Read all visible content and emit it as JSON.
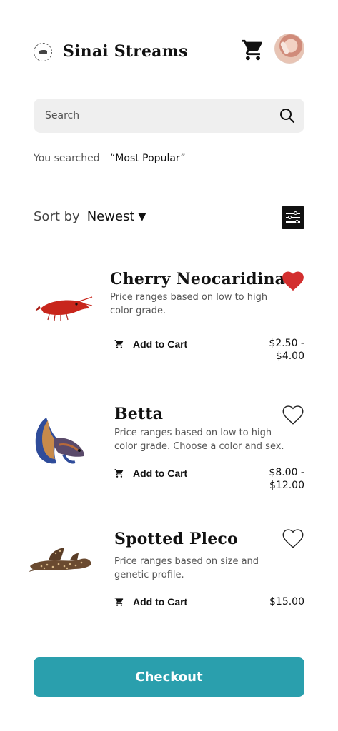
{
  "header": {
    "brand": "Sinai Streams",
    "logo_icon": "logo-icon",
    "cart_icon": "cart-icon"
  },
  "search": {
    "placeholder": "Search",
    "value": ""
  },
  "searched": {
    "label": "You searched",
    "term": "“Most Popular”"
  },
  "sort": {
    "label": "Sort by",
    "value": "Newest",
    "caret": "▼"
  },
  "products": [
    {
      "name": "Cherry Neocaridina",
      "description": "Price ranges based on low to high color grade.",
      "add_label": "Add to Cart",
      "price_line1": "$2.50 -",
      "price_line2": "$4.00",
      "favorited": true
    },
    {
      "name": "Betta",
      "description": "Price ranges based on low to high color grade. Choose a color and sex.",
      "add_label": "Add to Cart",
      "price_line1": "$8.00 -",
      "price_line2": "$12.00",
      "favorited": false
    },
    {
      "name": "Spotted Pleco",
      "description": "Price ranges based on size and genetic profile.",
      "add_label": "Add to Cart",
      "price_line1": "$15.00",
      "price_line2": "",
      "favorited": false
    }
  ],
  "checkout_label": "Checkout",
  "colors": {
    "accent": "#2a9fad",
    "heart_filled": "#d32f2f"
  }
}
